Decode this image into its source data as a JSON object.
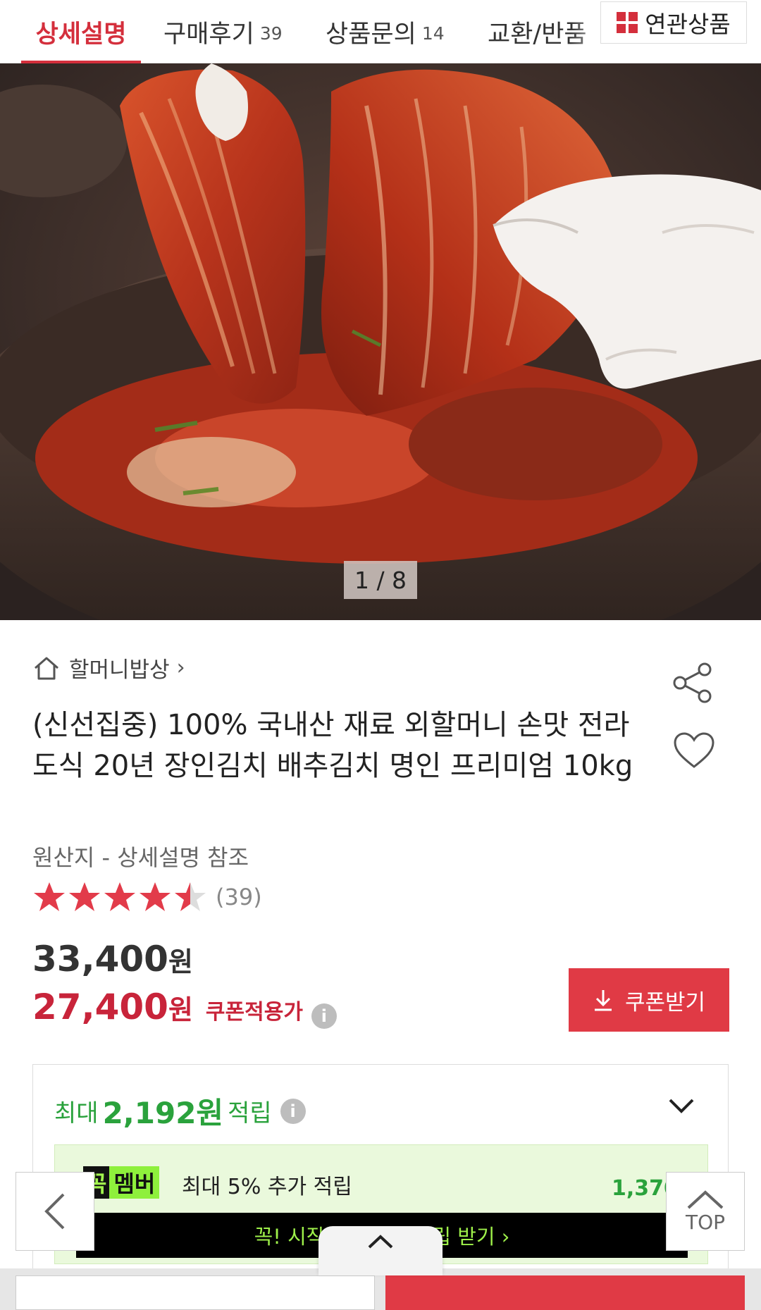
{
  "tabs": {
    "detail": "상세설명",
    "review": "구매후기",
    "review_count": "39",
    "qna": "상품문의",
    "qna_count": "14",
    "exchange": "교환/반품",
    "related": "연관상품"
  },
  "hero": {
    "pager": "1 / 8"
  },
  "product": {
    "store": "할머니밥상",
    "title": "(신선집중) 100% 국내산 재료 외할머니 손맛 전라도식 20년 장인김치 배추김치 명인 프리미엄 10kg",
    "origin": "원산지 - 상세설명 참조",
    "rating": 4.5,
    "review_count": "(39)"
  },
  "price": {
    "original": "33,400",
    "sale": "27,400",
    "currency": "원",
    "coupon_label": "쿠폰적용가",
    "coupon_button": "쿠폰받기"
  },
  "points": {
    "prefix": "최대",
    "amount": "2,192원",
    "suffix": "적립",
    "member_badge_k": "꼭",
    "member_badge_m": "멤버",
    "member_text": "최대 5% 추가 적립",
    "member_value": "1,370원",
    "member_cta": "꼭! 시작하고 최대 적립 받기  ›"
  },
  "controls": {
    "top": "TOP"
  },
  "colors": {
    "accent": "#d42f3c",
    "green": "#2aa23c",
    "coupon_bg": "#e03a45"
  }
}
